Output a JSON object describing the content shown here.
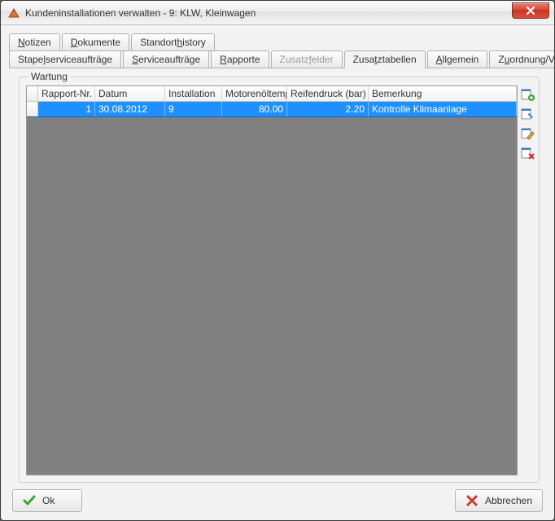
{
  "window": {
    "title": "Kundeninstallationen verwalten - 9: KLW, Kleinwagen"
  },
  "tabs_row1": [
    {
      "label": "Notizen",
      "accel": "N"
    },
    {
      "label": "Dokumente",
      "accel": "D"
    },
    {
      "label": "Standorthistory",
      "accel": "h"
    }
  ],
  "tabs_row2": [
    {
      "label": "Stapelserviceaufträge",
      "accel": "l",
      "state": "normal"
    },
    {
      "label": "Serviceaufträge",
      "accel": "S",
      "state": "normal"
    },
    {
      "label": "Rapporte",
      "accel": "R",
      "state": "normal"
    },
    {
      "label": "Zusatzfelder",
      "accel": "f",
      "state": "disabled"
    },
    {
      "label": "Zusatztabellen",
      "accel": "t",
      "state": "active"
    },
    {
      "label": "Allgemein",
      "accel": "A",
      "state": "normal"
    },
    {
      "label": "Zuordnung/Verträge",
      "accel": "u",
      "state": "normal"
    }
  ],
  "group_title": "Wartung",
  "grid": {
    "headers": {
      "rapport": "Rapport-Nr.",
      "datum": "Datum",
      "installation": "Installation",
      "oil": "Motorenöltempe",
      "reifen": "Reifendruck (bar)",
      "bemerk": "Bemerkung"
    },
    "rows": [
      {
        "rapport": "1",
        "datum": "30.08.2012",
        "installation": "9",
        "oil": "80.00",
        "reifen": "2.20",
        "bemerk": "Kontrolle Klimaanlage"
      }
    ]
  },
  "icons": {
    "add": "add-row-icon",
    "edit": "edit-row-icon",
    "note": "note-row-icon",
    "delete": "delete-row-icon"
  },
  "buttons": {
    "ok": "Ok",
    "cancel": "Abbrechen"
  }
}
